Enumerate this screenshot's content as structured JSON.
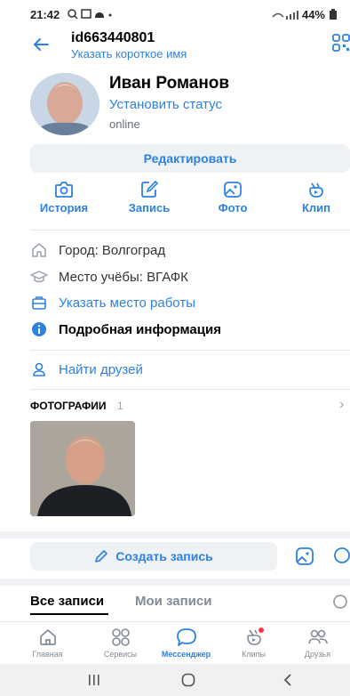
{
  "status_bar": {
    "time": "21:42",
    "battery": "44%"
  },
  "header": {
    "user_id": "id663440801",
    "short_name_link": "Указать короткое имя"
  },
  "profile": {
    "name": "Иван Романов",
    "set_status": "Установить статус",
    "presence": "online",
    "edit_button": "Редактировать"
  },
  "actions": [
    {
      "label": "История",
      "icon": "camera-icon"
    },
    {
      "label": "Запись",
      "icon": "pencil-square-icon"
    },
    {
      "label": "Фото",
      "icon": "image-icon"
    },
    {
      "label": "Клип",
      "icon": "clip-icon"
    }
  ],
  "info": {
    "city": "Город: Волгоград",
    "education": "Место учёбы: ВГАФК",
    "work_link": "Указать место работы",
    "details_link": "Подробная информация",
    "find_friends": "Найти друзей"
  },
  "photos": {
    "title": "ФОТОГРАФИИ",
    "count": "1"
  },
  "create_post": "Создать запись",
  "wall_tabs": {
    "all": "Все записи",
    "mine": "Мои записи"
  },
  "bottom_nav": [
    {
      "label": "Главная",
      "icon": "home-icon",
      "active": false
    },
    {
      "label": "Сервисы",
      "icon": "services-icon",
      "active": false
    },
    {
      "label": "Мессенджер",
      "icon": "messenger-icon",
      "active": true
    },
    {
      "label": "Клипы",
      "icon": "clips-icon",
      "active": false
    },
    {
      "label": "Друзья",
      "icon": "friends-icon",
      "active": false
    }
  ],
  "colors": {
    "accent": "#2d81e0",
    "secondary": "#818c99",
    "button_bg": "#eff2f5"
  }
}
